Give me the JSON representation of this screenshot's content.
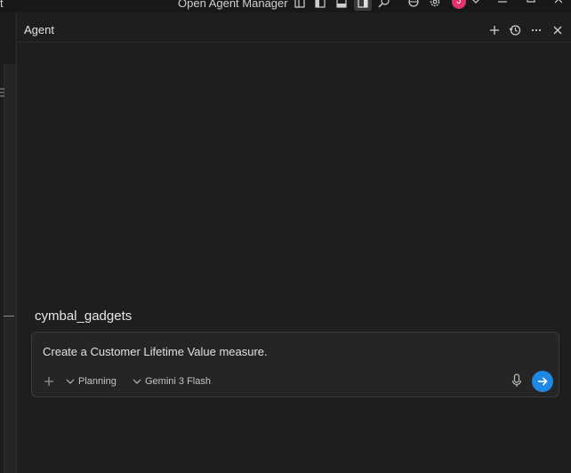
{
  "titlebar": {
    "menu_fragment": "t",
    "agent_manager_label": "Open Agent Manager",
    "avatar_initial": "J"
  },
  "panel": {
    "title": "Agent"
  },
  "workspace": {
    "name": "cymbal_gadgets"
  },
  "composer": {
    "prompt_text": "Create a Customer Lifetime Value measure.",
    "mode_label": "Planning",
    "model_label": "Gemini 3 Flash"
  },
  "colors": {
    "send_button": "#1e88e5",
    "avatar": "#e0336e"
  }
}
